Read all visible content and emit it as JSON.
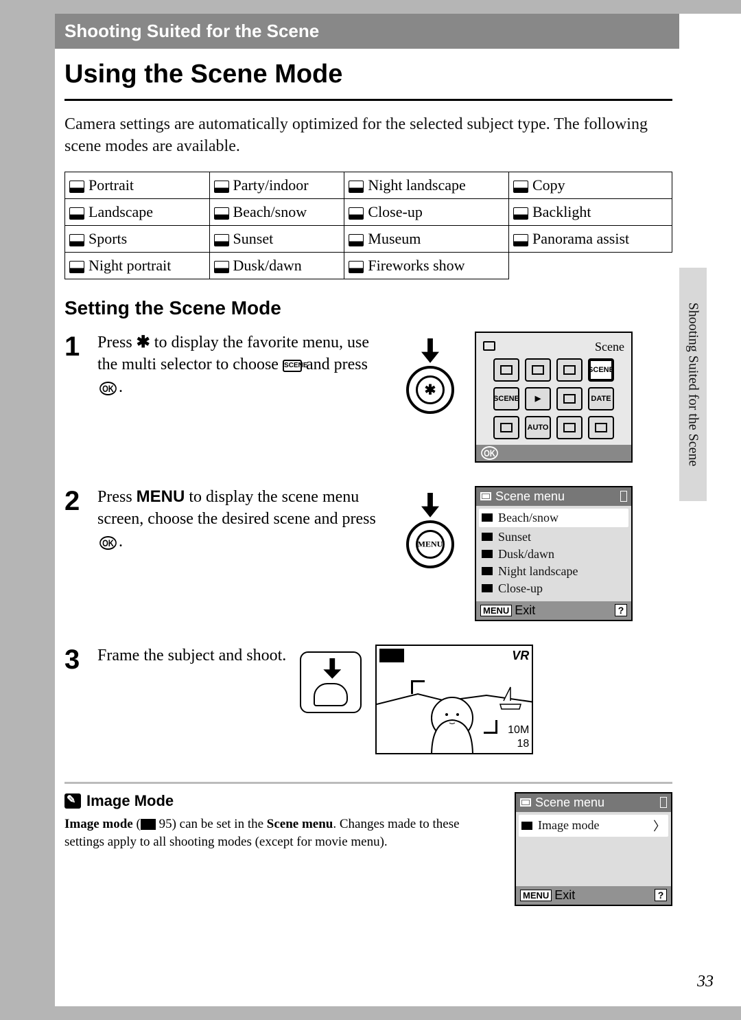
{
  "chapter": "Shooting Suited for the Scene",
  "side_tab": "Shooting Suited for the Scene",
  "title": "Using the Scene Mode",
  "intro": "Camera settings are automatically optimized for the selected subject type. The following scene modes are available.",
  "table": {
    "rows": [
      [
        "Portrait",
        "Party/indoor",
        "Night landscape",
        "Copy"
      ],
      [
        "Landscape",
        "Beach/snow",
        "Close-up",
        "Backlight"
      ],
      [
        "Sports",
        "Sunset",
        "Museum",
        "Panorama assist"
      ],
      [
        "Night portrait",
        "Dusk/dawn",
        "Fireworks show",
        ""
      ]
    ]
  },
  "setting_heading": "Setting the Scene Mode",
  "steps": [
    {
      "num": "1",
      "text_a": "Press ",
      "text_b": " to display the favorite menu, use the multi selector to choose ",
      "text_c": " and press ",
      "text_d": ".",
      "btn_label": "✱",
      "lcd_title": "Scene",
      "ok_label": "OK"
    },
    {
      "num": "2",
      "text_a": "Press ",
      "menu_word": "MENU",
      "text_b": " to display the scene menu screen, choose the desired scene and press ",
      "text_c": ".",
      "btn_label": "MENU",
      "lcd_head": "Scene menu",
      "lcd_items": [
        "Beach/snow",
        "Sunset",
        "Dusk/dawn",
        "Night landscape",
        "Close-up"
      ],
      "lcd_exit": "Exit",
      "menu_tag": "MENU",
      "q": "?"
    },
    {
      "num": "3",
      "text": "Frame the subject and shoot.",
      "shot_vr": "VR",
      "shot_count1": "10M",
      "shot_count2": "18"
    }
  ],
  "note": {
    "heading": "Image Mode",
    "body_a": "Image mode",
    "body_b": " (",
    "page_ref": " 95",
    "body_c": ") can be set in the ",
    "body_d": "Scene menu",
    "body_e": ". Changes made to these settings apply to all shooting modes (except for movie menu).",
    "lcd_head": "Scene menu",
    "lcd_item": "Image mode",
    "lcd_exit": "Exit",
    "menu_tag": "MENU",
    "q": "?"
  },
  "page_number": "33"
}
